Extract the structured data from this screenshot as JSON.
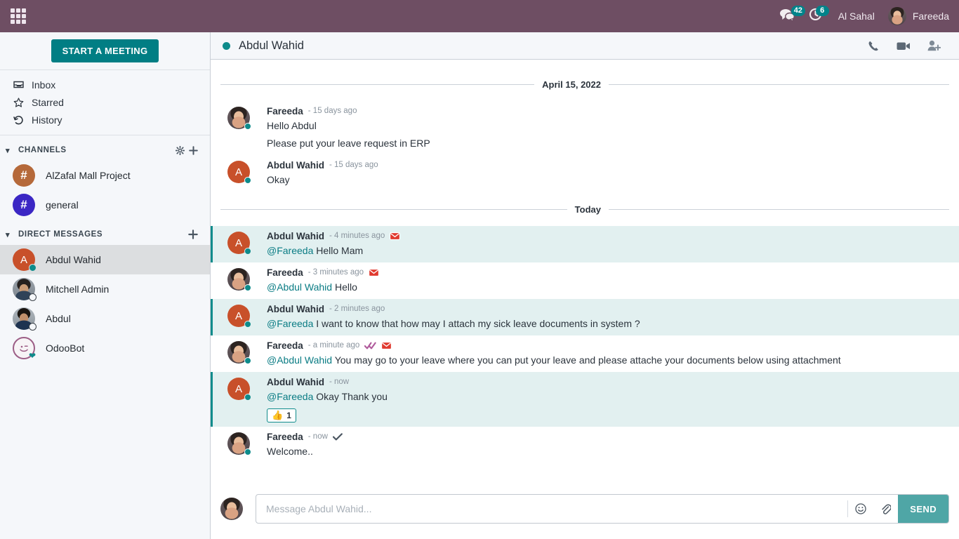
{
  "topbar": {
    "apps_icon": "apps-grid-icon",
    "messages": {
      "icon": "speech-bubble-icon",
      "badge": "42"
    },
    "activities": {
      "icon": "clock-activity-icon",
      "badge": "6"
    },
    "company": "Al Sahal",
    "user": "Fareeda"
  },
  "sidebar": {
    "start_meeting": "START A MEETING",
    "nav": [
      {
        "label": "Inbox",
        "icon": "inbox-icon"
      },
      {
        "label": "Starred",
        "icon": "star-icon"
      },
      {
        "label": "History",
        "icon": "history-icon"
      }
    ],
    "channels_section": {
      "title": "CHANNELS",
      "gear_icon": "gear-icon",
      "add_icon": "plus-icon",
      "items": [
        {
          "label": "AlZafal Mall Project",
          "avatar": "#",
          "color": "#B5693A"
        },
        {
          "label": "general",
          "avatar": "#",
          "color": "#3B27C4"
        }
      ]
    },
    "dm_section": {
      "title": "DIRECT MESSAGES",
      "add_icon": "plus-icon",
      "items": [
        {
          "label": "Abdul Wahid",
          "avatar": "A",
          "status": "online",
          "selected": true
        },
        {
          "label": "Mitchell Admin",
          "avatar": "",
          "status": "offline",
          "selected": false
        },
        {
          "label": "Abdul",
          "avatar": "",
          "status": "offline",
          "selected": false
        },
        {
          "label": "OdooBot",
          "avatar": "",
          "status": "bot",
          "selected": false
        }
      ]
    }
  },
  "chat": {
    "title": "Abdul Wahid",
    "status": "online",
    "actions": [
      {
        "name": "phone-call-icon"
      },
      {
        "name": "video-call-icon"
      },
      {
        "name": "add-user-icon"
      }
    ],
    "separators": {
      "first": "April 15, 2022",
      "second": "Today"
    },
    "messages": [
      {
        "author": "Fareeda",
        "time": "- 15 days ago",
        "avatar": "photo-f",
        "lines": [
          "Hello Abdul",
          "Please put your leave request in ERP"
        ],
        "highlight": false,
        "mention": "",
        "icons": []
      },
      {
        "author": "Abdul Wahid",
        "time": "- 15 days ago",
        "avatar": "letter-A",
        "lines": [
          "Okay"
        ],
        "highlight": false,
        "mention": "",
        "icons": []
      },
      {
        "author": "Abdul Wahid",
        "time": "- 4 minutes ago",
        "avatar": "letter-A",
        "mention": "@Fareeda",
        "lines": [
          "Hello Mam"
        ],
        "highlight": true,
        "icons": [
          "envelope"
        ]
      },
      {
        "author": "Fareeda",
        "time": "- 3 minutes ago",
        "avatar": "photo-f",
        "mention": "@Abdul Wahid",
        "lines": [
          "Hello"
        ],
        "highlight": false,
        "icons": [
          "envelope"
        ]
      },
      {
        "author": "Abdul Wahid",
        "time": "- 2 minutes ago",
        "avatar": "letter-A",
        "mention": "@Fareeda",
        "lines": [
          "I want to know that how may I attach my sick leave documents in system ?"
        ],
        "highlight": true,
        "icons": []
      },
      {
        "author": "Fareeda",
        "time": "- a minute ago",
        "avatar": "photo-f",
        "mention": "@Abdul Wahid",
        "lines": [
          "You may go to your leave where you can put your leave and please attache your documents below using attachment"
        ],
        "highlight": false,
        "icons": [
          "double-check",
          "envelope"
        ]
      },
      {
        "author": "Abdul Wahid",
        "time": "- now",
        "avatar": "letter-A",
        "mention": "@Fareeda",
        "lines": [
          "Okay Thank you"
        ],
        "highlight": true,
        "icons": [],
        "reaction": {
          "emoji": "👍",
          "count": "1"
        }
      },
      {
        "author": "Fareeda",
        "time": "- now",
        "avatar": "photo-f",
        "lines": [
          "Welcome.."
        ],
        "highlight": false,
        "mention": "",
        "icons": [
          "check"
        ]
      }
    ]
  },
  "composer": {
    "placeholder": "Message Abdul Wahid...",
    "value": "",
    "emoji_icon": "emoji-smiley-icon",
    "attach_icon": "paperclip-icon",
    "send_label": "SEND"
  },
  "colors": {
    "topbar": "#6E4E63",
    "accent_teal": "#017E84",
    "send_teal": "#4FA6A6",
    "highlight_bg": "#E2F0F0",
    "badge": "#00838A"
  }
}
